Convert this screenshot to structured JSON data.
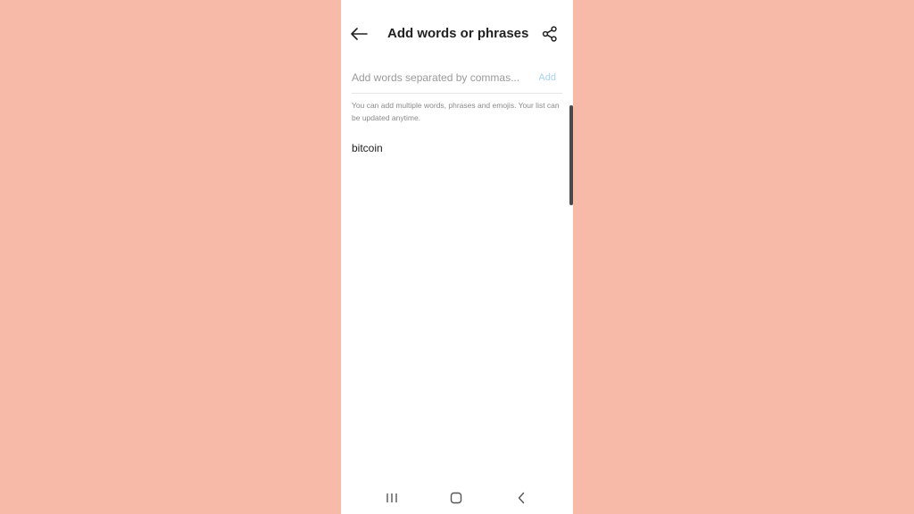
{
  "header": {
    "title": "Add words or phrases",
    "back_icon": "arrow-left-icon",
    "share_icon": "share-icon"
  },
  "input": {
    "placeholder": "Add words separated by commas...",
    "value": "",
    "add_label": "Add"
  },
  "helper_text": "You can add multiple words, phrases and emojis. Your list can be updated anytime.",
  "words": [
    {
      "text": "bitcoin"
    }
  ],
  "navbar": {
    "recent_icon": "recent-apps-icon",
    "home_icon": "home-icon",
    "back_icon": "nav-back-icon"
  },
  "colors": {
    "background": "#F7BAA8",
    "add_button": "#A8D3F0",
    "text": "#222222"
  }
}
